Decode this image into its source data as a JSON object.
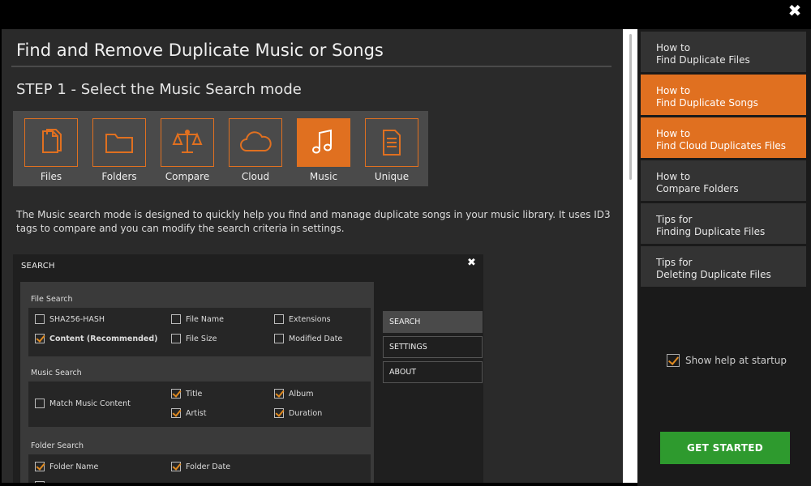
{
  "window": {
    "close_glyph": "✖"
  },
  "main": {
    "title": "Find and Remove Duplicate Music or Songs",
    "step_title": "STEP 1 - Select the Music Search mode",
    "modes": [
      {
        "label": "Files",
        "icon": "files-icon"
      },
      {
        "label": "Folders",
        "icon": "folder-icon"
      },
      {
        "label": "Compare",
        "icon": "scales-icon"
      },
      {
        "label": "Cloud",
        "icon": "cloud-icon"
      },
      {
        "label": "Music",
        "icon": "music-note-icon",
        "active": true
      },
      {
        "label": "Unique",
        "icon": "document-icon"
      }
    ],
    "description": "The Music search mode is designed to quickly help you find and manage duplicate songs in your music library. It uses ID3 tags to compare and you can modify the search criteria in settings."
  },
  "search_window": {
    "title": "SEARCH",
    "close_glyph": "✖",
    "file_search": {
      "label": "File Search",
      "options": [
        {
          "label": "SHA256-HASH",
          "checked": false
        },
        {
          "label": "File Name",
          "checked": false
        },
        {
          "label": "Extensions",
          "checked": false
        },
        {
          "label": "Content (Recommended)",
          "checked": true
        },
        {
          "label": "File Size",
          "checked": false
        },
        {
          "label": "Modified Date",
          "checked": false
        }
      ]
    },
    "music_search": {
      "label": "Music Search",
      "options": [
        {
          "label": "Match Music Content",
          "checked": false
        },
        {
          "label": "Title",
          "checked": true
        },
        {
          "label": "Album",
          "checked": true
        },
        {
          "label": "Artist",
          "checked": true
        },
        {
          "label": "Duration",
          "checked": true
        }
      ]
    },
    "folder_search": {
      "label": "Folder Search",
      "options": [
        {
          "label": "Folder Name",
          "checked": true
        },
        {
          "label": "Folder Date",
          "checked": true
        }
      ]
    },
    "tabs": [
      {
        "label": "SEARCH",
        "active": true
      },
      {
        "label": "SETTINGS"
      },
      {
        "label": "ABOUT"
      }
    ]
  },
  "sidebar": {
    "items": [
      {
        "line1": "How to",
        "line2": "Find Duplicate Files",
        "highlight": false
      },
      {
        "line1": "How to",
        "line2": "Find Duplicate Songs",
        "highlight": true
      },
      {
        "line1": "How to",
        "line2": "Find Cloud Duplicates Files",
        "highlight": true
      },
      {
        "line1": "How to",
        "line2": "Compare Folders",
        "highlight": false
      },
      {
        "line1": "Tips for",
        "line2": "Finding Duplicate Files",
        "highlight": false
      },
      {
        "line1": "Tips for",
        "line2": "Deleting Duplicate Files",
        "highlight": false
      }
    ],
    "show_help_label": "Show help at startup",
    "show_help_checked": true,
    "get_started_label": "GET STARTED"
  },
  "colors": {
    "accent": "#e07020",
    "success": "#2e9a2e"
  }
}
